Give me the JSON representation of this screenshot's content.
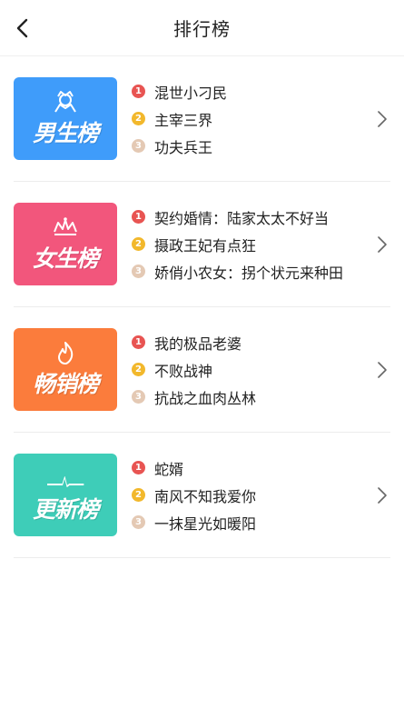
{
  "header": {
    "title": "排行榜"
  },
  "colors": {
    "rank": [
      "#e85452",
      "#f2b82c",
      "#e4c9b4"
    ],
    "male": "#3f9cfa",
    "female": "#f2567c",
    "bestseller": "#fb7c3c",
    "update": "#3ecdb8"
  },
  "charts": [
    {
      "label": "男生榜",
      "icon": "crown-badge-icon",
      "books": [
        {
          "rank": "1",
          "title": "混世小刁民"
        },
        {
          "rank": "2",
          "title": "主宰三界"
        },
        {
          "rank": "3",
          "title": "功夫兵王"
        }
      ]
    },
    {
      "label": "女生榜",
      "icon": "tiara-icon",
      "books": [
        {
          "rank": "1",
          "title": "契约婚情：陆家太太不好当"
        },
        {
          "rank": "2",
          "title": "摄政王妃有点狂"
        },
        {
          "rank": "3",
          "title": "娇俏小农女：拐个状元来种田"
        }
      ]
    },
    {
      "label": "畅销榜",
      "icon": "flame-icon",
      "books": [
        {
          "rank": "1",
          "title": "我的极品老婆"
        },
        {
          "rank": "2",
          "title": "不败战神"
        },
        {
          "rank": "3",
          "title": "抗战之血肉丛林"
        }
      ]
    },
    {
      "label": "更新榜",
      "icon": "pulse-line-icon",
      "books": [
        {
          "rank": "1",
          "title": "蛇婿"
        },
        {
          "rank": "2",
          "title": "南风不知我爱你"
        },
        {
          "rank": "3",
          "title": "一抹星光如暖阳"
        }
      ]
    }
  ]
}
